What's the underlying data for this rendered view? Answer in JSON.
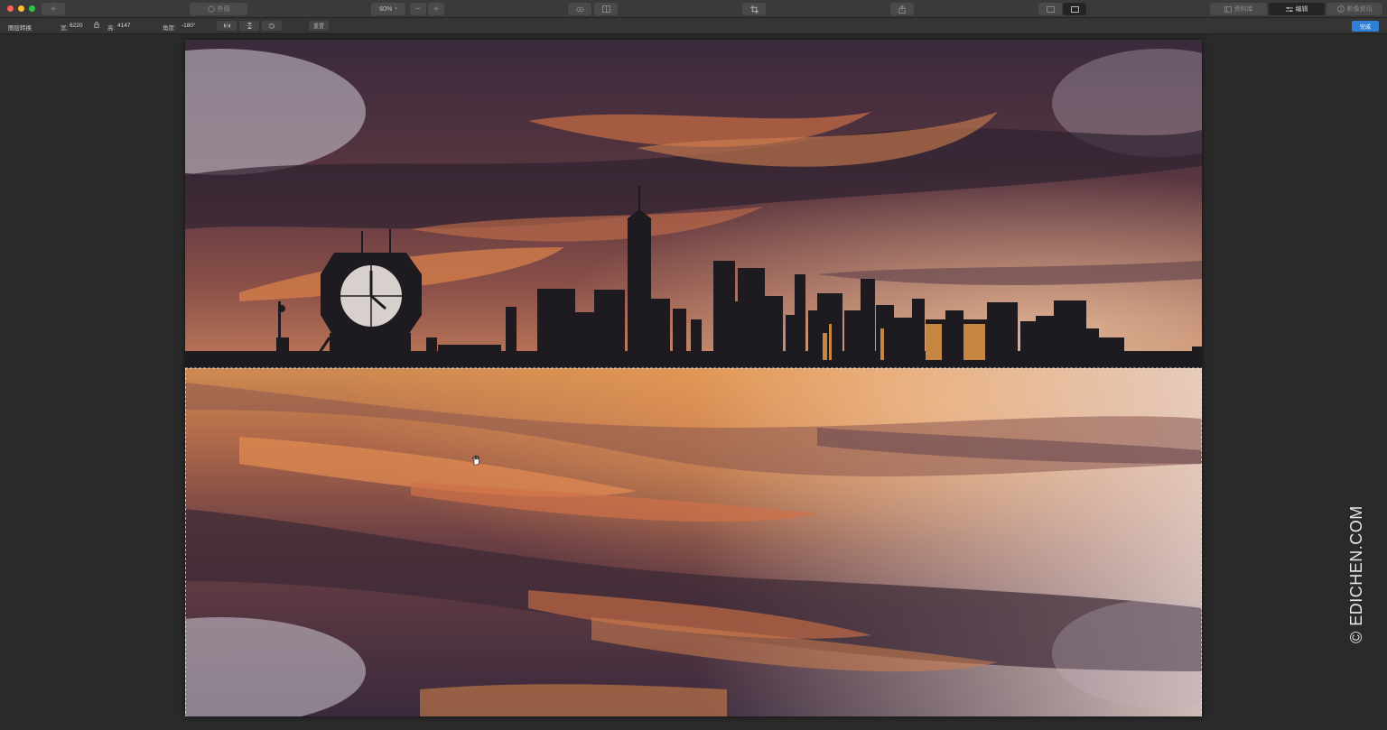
{
  "window": {
    "traffic_lights": [
      "#ff5f57",
      "#febc2e",
      "#28c840"
    ],
    "add_label": "+",
    "appearance_label": "外观",
    "zoom": "60%",
    "zoom_minus": "−",
    "zoom_plus": "+",
    "library_label": "资料库",
    "edit_label": "编辑",
    "info_label": "影像资讯"
  },
  "transform_bar": {
    "title": "图层转换",
    "width_label": "宽:",
    "width_value": "6220",
    "height_label": "高:",
    "height_value": "4147",
    "angle_label": "角度:",
    "angle_value": "-180°",
    "reset_label": "重置",
    "done_label": "完成"
  },
  "watermark": "© EDICHEN.COM",
  "colors": {
    "accent": "#2f7fd6",
    "background": "#2a2a2a"
  }
}
